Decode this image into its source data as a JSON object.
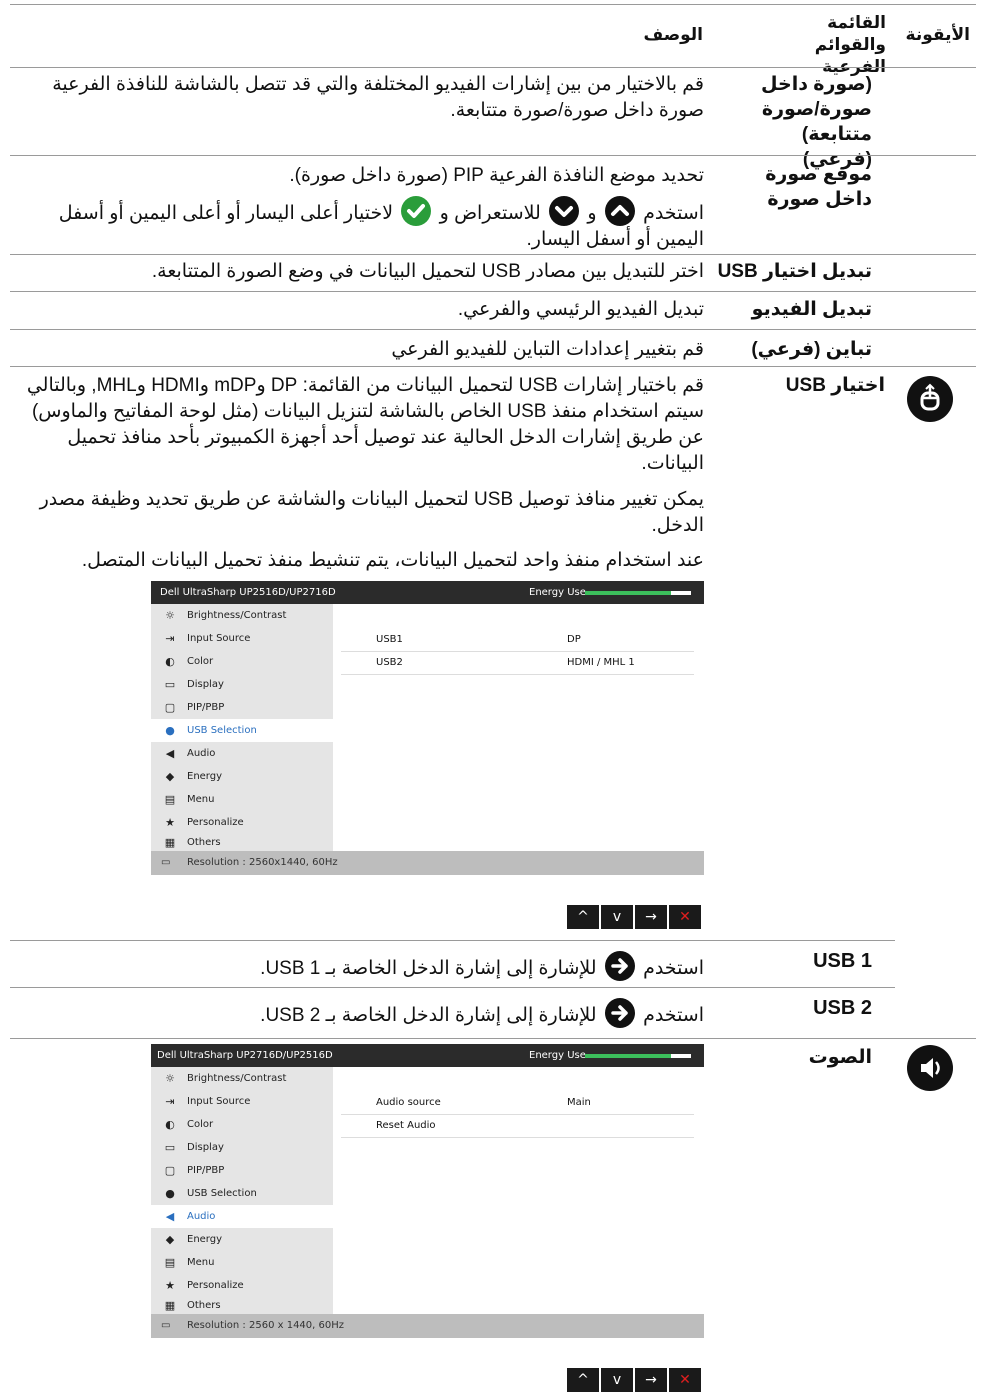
{
  "header": {
    "icon_col": "الأيقونة",
    "menu_col": "القائمة والقوائم الفرعية",
    "desc_col": "الوصف"
  },
  "rows": {
    "pip_pbp_sub": {
      "menu": "(صورة داخل صورة/صورة متتابعة) (فرعي)",
      "desc": "قم بالاختيار من بين إشارات الفيديو المختلفة والتي قد تتصل بالشاشة للنافذة الفرعية صورة داخل صورة/صورة متتابعة."
    },
    "pip_location": {
      "menu": "موقع صورة داخل صورة",
      "desc_1": "تحديد موضع النافذة الفرعية PIP (صورة داخل صورة).",
      "desc_2a": "استخدم",
      "desc_2b": "و",
      "desc_2c": "للاستعراض و",
      "desc_2d": "لاختيار أعلى اليسار أو أعلى اليمين أو أسفل اليمين أو أسفل اليسار."
    },
    "usb_switch": {
      "menu": "تبديل اختيار USB",
      "desc": "اختر للتبديل بين مصادر USB لتحميل البيانات في وضع الصورة المتتابعة."
    },
    "video_swap": {
      "menu": "تبديل الفيديو",
      "desc": "تبديل الفيديو الرئيسي والفرعي."
    },
    "contrast_sub": {
      "menu": "تباين (فرعي)",
      "desc": "قم بتغيير إعدادات التباين للفيديو الفرعي"
    },
    "usb_selection": {
      "menu": "اختيار USB",
      "para_1": "قم باختيار إشارات USB لتحميل البيانات من القائمة: DP وmDP وHDMI وMHL, وبالتالي سيتم استخدام منفذ USB الخاص بالشاشة لتنزيل البيانات (مثل لوحة المفاتيح والماوس) عن طريق إشارات الدخل الحالية عند توصيل أحد أجهزة الكمبيوتر بأحد منافذ تحميل البيانات.",
      "para_2": "يمكن تغيير منافذ توصيل USB لتحميل البيانات والشاشة عن طريق تحديد وظيفة مصدر الدخل.",
      "para_3": "عند استخدام منفذ واحد لتحميل البيانات، يتم تنشيط منفذ تحميل البيانات المتصل."
    },
    "usb1": {
      "menu": "USB 1",
      "desc_a": "استخدم",
      "desc_b": "للإشارة إلى إشارة الدخل الخاصة بـ USB 1."
    },
    "usb2": {
      "menu": "USB 2",
      "desc_a": "استخدم",
      "desc_b": "للإشارة إلى إشارة الدخل الخاصة بـ USB 2."
    },
    "audio": {
      "menu": "الصوت"
    }
  },
  "osd_usb": {
    "title": "Dell UltraSharp UP2516D/UP2716D",
    "energy": "Energy Use",
    "energy_level": 0.8,
    "menu": [
      "Brightness/Contrast",
      "Input Source",
      "Color",
      "Display",
      "PIP/PBP",
      "USB Selection",
      "Audio",
      "Energy",
      "Menu",
      "Personalize",
      "Others"
    ],
    "selected": "USB Selection",
    "rows": [
      {
        "k": "USB1",
        "v": "DP"
      },
      {
        "k": "USB2",
        "v": "HDMI / MHL 1"
      }
    ],
    "footer": "Resolution : 2560x1440, 60Hz"
  },
  "osd_audio": {
    "title": "Dell UltraSharp UP2716D/UP2516D",
    "energy": "Energy Use",
    "energy_level": 0.8,
    "menu": [
      "Brightness/Contrast",
      "Input Source",
      "Color",
      "Display",
      "PIP/PBP",
      "USB Selection",
      "Audio",
      "Energy",
      "Menu",
      "Personalize",
      "Others"
    ],
    "selected": "Audio",
    "rows": [
      {
        "k": "Audio source",
        "v": "Main"
      },
      {
        "k": "Reset Audio",
        "v": ""
      }
    ],
    "footer": "Resolution : 2560 x 1440, 60Hz"
  },
  "nav_buttons": {
    "up": "^",
    "down": "v",
    "right": "→",
    "close": "✕"
  },
  "colors": {
    "accent_green": "#2a9d3a",
    "osd_selected": "#2a6fbf",
    "close_red": "#e01e1e"
  }
}
